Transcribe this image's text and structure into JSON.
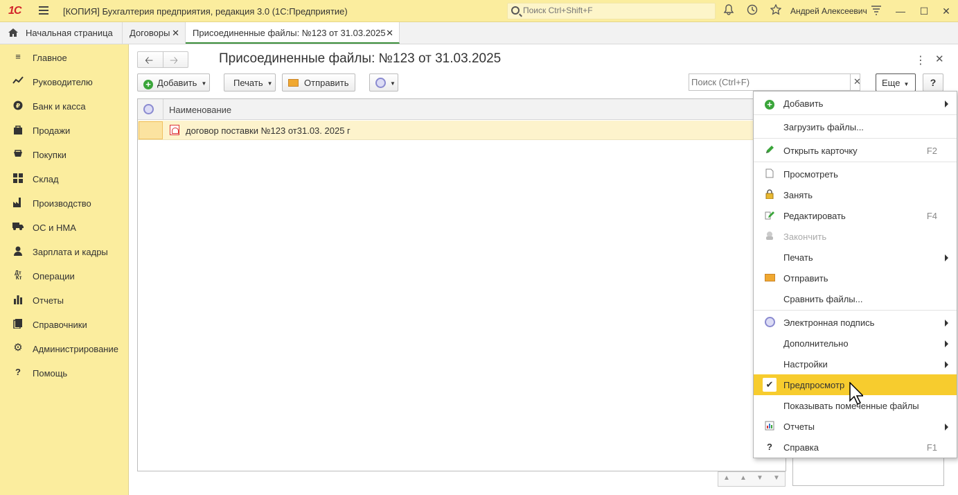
{
  "titlebar": {
    "logo": "1С",
    "title": "[КОПИЯ] Бухгалтерия предприятия, редакция 3.0  (1С:Предприятие)",
    "search_placeholder": "Поиск Ctrl+Shift+F",
    "user": "Андрей Алексеевич"
  },
  "tabs": [
    {
      "label": "Начальная страница"
    },
    {
      "label": "Договоры"
    },
    {
      "label": "Присоединенные файлы: №123 от 31.03.2025"
    }
  ],
  "sidebar": {
    "items": [
      {
        "label": "Главное",
        "icon": "menu-icon"
      },
      {
        "label": "Руководителю",
        "icon": "trend-icon"
      },
      {
        "label": "Банк и касса",
        "icon": "coin-icon"
      },
      {
        "label": "Продажи",
        "icon": "bag-icon"
      },
      {
        "label": "Покупки",
        "icon": "cart-icon"
      },
      {
        "label": "Склад",
        "icon": "grid-icon"
      },
      {
        "label": "Производство",
        "icon": "factory-icon"
      },
      {
        "label": "ОС и НМА",
        "icon": "truck-icon"
      },
      {
        "label": "Зарплата и кадры",
        "icon": "person-icon"
      },
      {
        "label": "Операции",
        "icon": "dt-kt-icon"
      },
      {
        "label": "Отчеты",
        "icon": "bar-chart-icon"
      },
      {
        "label": "Справочники",
        "icon": "book-icon"
      },
      {
        "label": "Администрирование",
        "icon": "gear-icon"
      },
      {
        "label": "Помощь",
        "icon": "question-icon"
      }
    ]
  },
  "main": {
    "title": "Присоединенные файлы: №123 от 31.03.2025",
    "toolbar": {
      "add": "Добавить",
      "print": "Печать",
      "send": "Отправить",
      "search_placeholder": "Поиск (Ctrl+F)",
      "more": "Еще",
      "help": "?"
    },
    "table": {
      "column_name": "Наименование",
      "rows": [
        {
          "name": "договор поставки №123 от31.03. 2025 г"
        }
      ]
    }
  },
  "menu": {
    "items": [
      {
        "label": "Добавить",
        "shortcut": "",
        "submenu": true
      },
      {
        "label": "Загрузить файлы...",
        "shortcut": ""
      },
      {
        "label": "Открыть карточку",
        "shortcut": "F2"
      },
      {
        "label": "Просмотреть",
        "shortcut": ""
      },
      {
        "label": "Занять",
        "shortcut": ""
      },
      {
        "label": "Редактировать",
        "shortcut": "F4"
      },
      {
        "label": "Закончить",
        "shortcut": "",
        "disabled": true
      },
      {
        "label": "Печать",
        "shortcut": "",
        "submenu": true
      },
      {
        "label": "Отправить",
        "shortcut": ""
      },
      {
        "label": "Сравнить файлы...",
        "shortcut": ""
      },
      {
        "label": "Электронная подпись",
        "shortcut": "",
        "submenu": true
      },
      {
        "label": "Дополнительно",
        "shortcut": "",
        "submenu": true
      },
      {
        "label": "Настройки",
        "shortcut": "",
        "submenu": true
      },
      {
        "label": "Предпросмотр",
        "shortcut": "",
        "checked": true
      },
      {
        "label": "Показывать помеченные файлы",
        "shortcut": ""
      },
      {
        "label": "Отчеты",
        "shortcut": "",
        "submenu": true
      },
      {
        "label": "Справка",
        "shortcut": "F1"
      }
    ]
  },
  "colors": {
    "sidebar_bg": "#fbed9e",
    "highlight": "#f7cc2e",
    "active_tab_underline": "#3b8e3b",
    "selected_row": "#fdf3cc"
  }
}
